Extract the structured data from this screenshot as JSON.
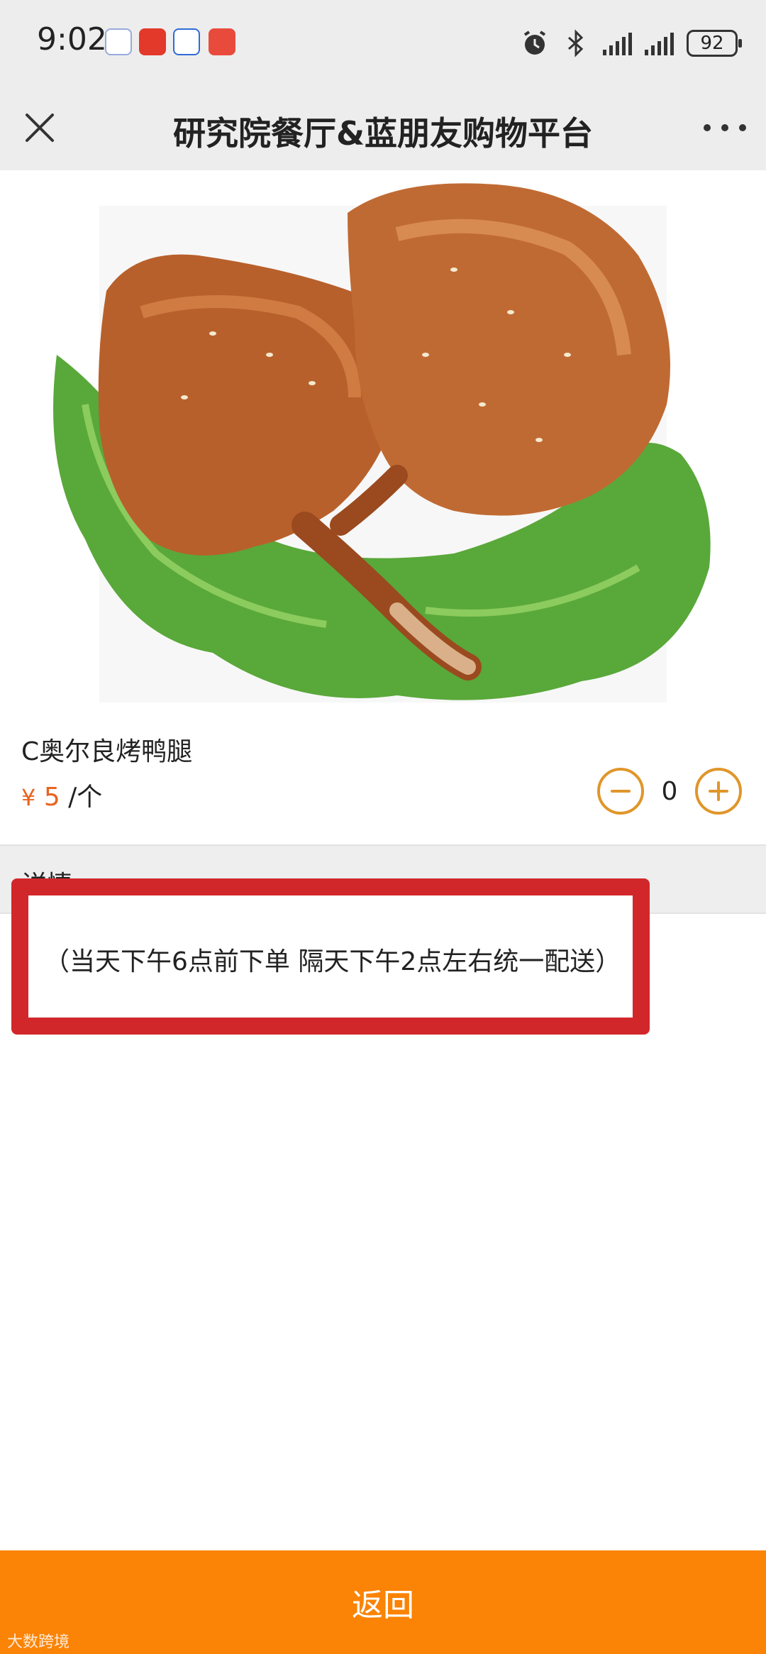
{
  "status_bar": {
    "time": "9:02",
    "battery": "92",
    "icons": [
      "qq-icon",
      "taobao-icon",
      "baidu-icon",
      "red-envelope-icon",
      "alarm-icon",
      "bluetooth-icon",
      "signal-icon",
      "signal-icon"
    ]
  },
  "nav": {
    "title": "研究院餐厅&蓝朋友购物平台"
  },
  "product": {
    "name": "C奥尔良烤鸭腿",
    "currency": "¥",
    "price": "5",
    "unit": "/个",
    "quantity": "0"
  },
  "details": {
    "label": "详情",
    "note": "（当天下午6点前下单 隔天下午2点左右统一配送）"
  },
  "bottom": {
    "back_label": "返回",
    "watermark": "大数跨境"
  },
  "colors": {
    "accent": "#fb8305",
    "price": "#e8641f",
    "stepper": "#e0962a",
    "highlight_border": "#d2272a"
  }
}
